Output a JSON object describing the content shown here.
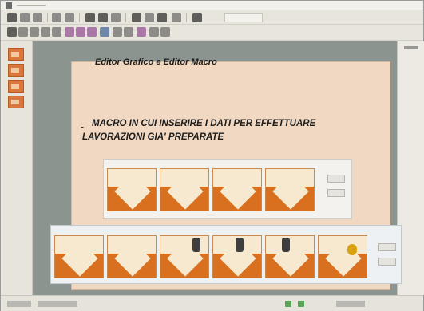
{
  "slide": {
    "title": "Editor Grafico e Editor Macro",
    "bullet": "-",
    "line1": "MACRO IN CUI INSERIRE I DATI PER EFFETTUARE",
    "line2": "LAVORAZIONI GIA' PREPARATE"
  },
  "colors": {
    "accent_orange": "#d9701f",
    "slide_background": "#f1d8c2",
    "workspace_background": "#8c9490"
  }
}
